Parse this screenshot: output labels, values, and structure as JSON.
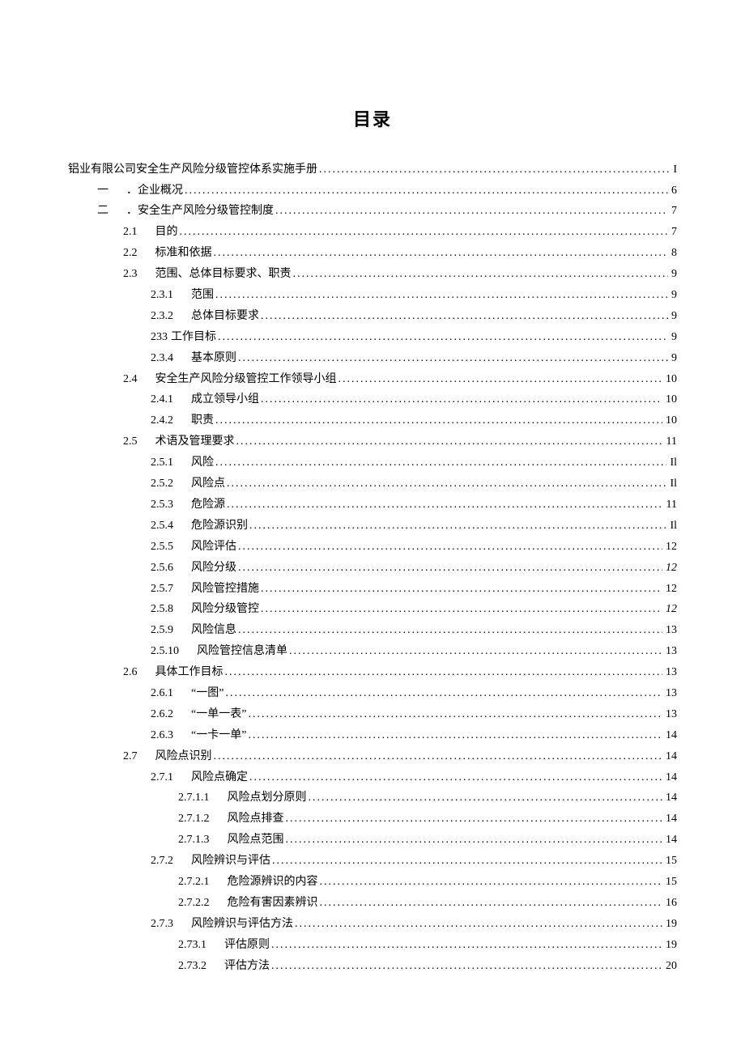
{
  "title": "目录",
  "entries": [
    {
      "indent": 0,
      "label": "",
      "text": "铝业有限公司安全生产风险分级管控体系实施手册",
      "page": "I",
      "italic": false
    },
    {
      "indent": 1,
      "label": "一",
      "text": "．企业概况",
      "page": "6",
      "italic": false
    },
    {
      "indent": 1,
      "label": "二",
      "text": "．安全生产风险分级管控制度",
      "page": "7",
      "italic": false
    },
    {
      "indent": 2,
      "label": "2.1",
      "text": "目的",
      "page": "7",
      "italic": false
    },
    {
      "indent": 2,
      "label": "2.2",
      "text": "标准和依据",
      "page": "8",
      "italic": false
    },
    {
      "indent": 2,
      "label": "2.3",
      "text": "范围、总体目标要求、职责",
      "page": "9",
      "italic": false
    },
    {
      "indent": 3,
      "label": "2.3.1",
      "text": "范围",
      "page": "9",
      "italic": false
    },
    {
      "indent": 3,
      "label": "2.3.2",
      "text": "总体目标要求",
      "page": "9",
      "italic": false
    },
    {
      "indent": 3,
      "label": "233",
      "text": "工作目标",
      "page": "9",
      "italic": false,
      "nolabelgap": true
    },
    {
      "indent": 3,
      "label": "2.3.4",
      "text": "基本原则",
      "page": "9",
      "italic": false
    },
    {
      "indent": 2,
      "label": "2.4",
      "text": "安全生产风险分级管控工作领导小组",
      "page": "10",
      "italic": false
    },
    {
      "indent": 3,
      "label": "2.4.1",
      "text": "成立领导小组",
      "page": "10",
      "italic": false
    },
    {
      "indent": 3,
      "label": "2.4.2",
      "text": "职责",
      "page": "10",
      "italic": false
    },
    {
      "indent": 2,
      "label": "2.5",
      "text": "术语及管理要求",
      "page": "11",
      "italic": false
    },
    {
      "indent": 3,
      "label": "2.5.1",
      "text": "风险",
      "page": "Il",
      "italic": false
    },
    {
      "indent": 3,
      "label": "2.5.2",
      "text": "风险点",
      "page": "Il",
      "italic": false
    },
    {
      "indent": 3,
      "label": "2.5.3",
      "text": "危险源",
      "page": "11",
      "italic": false
    },
    {
      "indent": 3,
      "label": "2.5.4",
      "text": "危险源识别",
      "page": "Il",
      "italic": false
    },
    {
      "indent": 3,
      "label": "2.5.5",
      "text": "风险评估",
      "page": "12",
      "italic": false
    },
    {
      "indent": 3,
      "label": "2.5.6",
      "text": "风险分级",
      "page": "12",
      "italic": true
    },
    {
      "indent": 3,
      "label": "2.5.7",
      "text": "风险管控措施",
      "page": "12",
      "italic": false
    },
    {
      "indent": 3,
      "label": "2.5.8",
      "text": "风险分级管控",
      "page": "12",
      "italic": true
    },
    {
      "indent": 3,
      "label": "2.5.9",
      "text": "风险信息",
      "page": "13",
      "italic": false
    },
    {
      "indent": 3,
      "label": "2.5.10",
      "text": "风险管控信息清单",
      "page": "13",
      "italic": false
    },
    {
      "indent": 2,
      "label": "2.6",
      "text": "具体工作目标",
      "page": "13",
      "italic": false
    },
    {
      "indent": 3,
      "label": "2.6.1",
      "text": "“一图”",
      "page": "13",
      "italic": false
    },
    {
      "indent": 3,
      "label": "2.6.2",
      "text": "“一单一表”",
      "page": "13",
      "italic": false
    },
    {
      "indent": 3,
      "label": "2.6.3",
      "text": "“一卡一单”",
      "page": "14",
      "italic": false
    },
    {
      "indent": 2,
      "label": "2.7",
      "text": "风险点识别",
      "page": "14",
      "italic": false
    },
    {
      "indent": 3,
      "label": "2.7.1",
      "text": "风险点确定",
      "page": "14",
      "italic": false
    },
    {
      "indent": 4,
      "label": "2.7.1.1",
      "text": "风险点划分原则",
      "page": "14",
      "italic": false
    },
    {
      "indent": 4,
      "label": "2.7.1.2",
      "text": "风险点排查",
      "page": "14",
      "italic": false
    },
    {
      "indent": 4,
      "label": "2.7.1.3",
      "text": "风险点范围",
      "page": "14",
      "italic": false
    },
    {
      "indent": 3,
      "label": "2.7.2",
      "text": "风险辨识与评估",
      "page": "15",
      "italic": false
    },
    {
      "indent": 4,
      "label": "2.7.2.1",
      "text": "危险源辨识的内容",
      "page": "15",
      "italic": false
    },
    {
      "indent": 4,
      "label": "2.7.2.2",
      "text": "危险有害因素辨识",
      "page": "16",
      "italic": false
    },
    {
      "indent": 3,
      "label": "2.7.3",
      "text": "风险辨识与评估方法",
      "page": "19",
      "italic": false
    },
    {
      "indent": 4,
      "label": "2.73.1",
      "text": "评估原则",
      "page": "19",
      "italic": false
    },
    {
      "indent": 4,
      "label": "2.73.2",
      "text": "评估方法",
      "page": "20",
      "italic": false
    }
  ]
}
